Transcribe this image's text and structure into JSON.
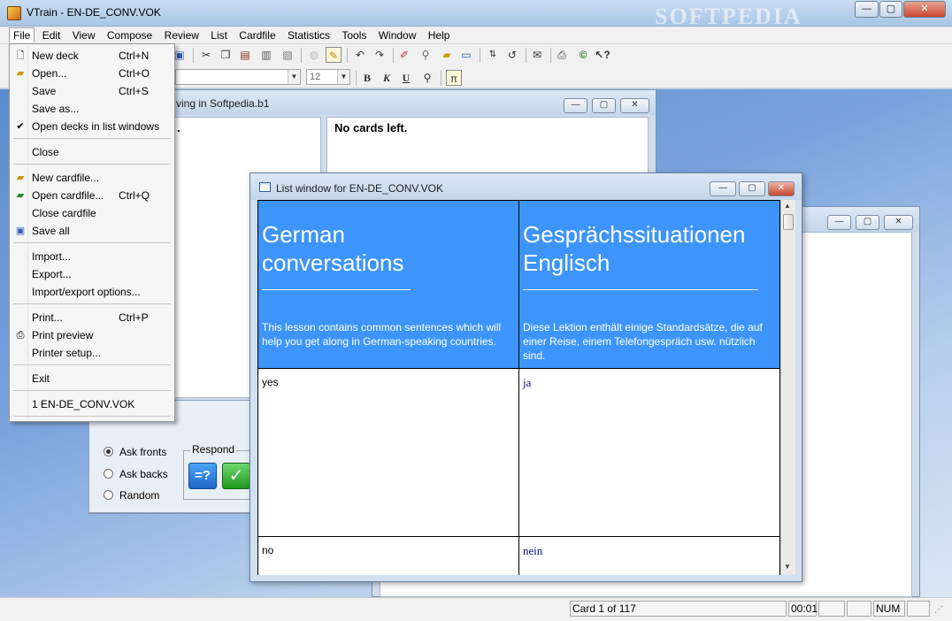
{
  "window": {
    "title": "VTrain - EN-DE_CONV.VOK",
    "minimize": "—",
    "maximize": "▢",
    "close": "✕"
  },
  "menubar": [
    "File",
    "Edit",
    "View",
    "Compose",
    "Review",
    "List",
    "Cardfile",
    "Statistics",
    "Tools",
    "Window",
    "Help"
  ],
  "toolbar": {
    "font_size": "12",
    "bold": "B",
    "italic": "K",
    "underline": "U",
    "pi": "π"
  },
  "file_menu": {
    "items": [
      {
        "label": "New deck",
        "shortcut": "Ctrl+N"
      },
      {
        "label": "Open...",
        "shortcut": "Ctrl+O"
      },
      {
        "label": "Save",
        "shortcut": "Ctrl+S"
      },
      {
        "label": "Save as...",
        "shortcut": ""
      },
      {
        "label": "Open decks in list windows",
        "shortcut": ""
      },
      {
        "label": "Close",
        "shortcut": ""
      },
      {
        "label": "New cardfile...",
        "shortcut": ""
      },
      {
        "label": "Open cardfile...",
        "shortcut": "Ctrl+Q"
      },
      {
        "label": "Close cardfile",
        "shortcut": ""
      },
      {
        "label": "Save all",
        "shortcut": ""
      },
      {
        "label": "Import...",
        "shortcut": ""
      },
      {
        "label": "Export...",
        "shortcut": ""
      },
      {
        "label": "Import/export options...",
        "shortcut": ""
      },
      {
        "label": "Print...",
        "shortcut": "Ctrl+P"
      },
      {
        "label": "Print preview",
        "shortcut": ""
      },
      {
        "label": "Printer setup...",
        "shortcut": ""
      },
      {
        "label": "Exit",
        "shortcut": ""
      },
      {
        "label": "1 EN-DE_CONV.VOK",
        "shortcut": ""
      }
    ]
  },
  "review_window": {
    "title": "ving in Softpedia.b1",
    "left_text": ".",
    "right_text": "No cards left.",
    "ask_fronts": "Ask fronts",
    "ask_backs": "Ask backs",
    "random": "Random",
    "respond": "Respond",
    "respond_ask": "=?",
    "respond_ok": "✓"
  },
  "list_window": {
    "title": "List window for EN-DE_CONV.VOK",
    "header_front_title": "German conversations",
    "header_front_desc": "This lesson contains common sentences which will help you get along in German-speaking countries.",
    "header_back_title": "Gesprächssituationen Englisch",
    "header_back_desc": "Diese Lektion enthält einige Standardsätze, die auf einer Reise, einem Telefongespräch usw. nützlich sind.",
    "rows": [
      {
        "front": "yes",
        "back": "ja"
      },
      {
        "front": "no",
        "back": "nein"
      }
    ]
  },
  "statusbar": {
    "card": "Card 1 of 117",
    "time": "00:01",
    "num": "NUM"
  }
}
